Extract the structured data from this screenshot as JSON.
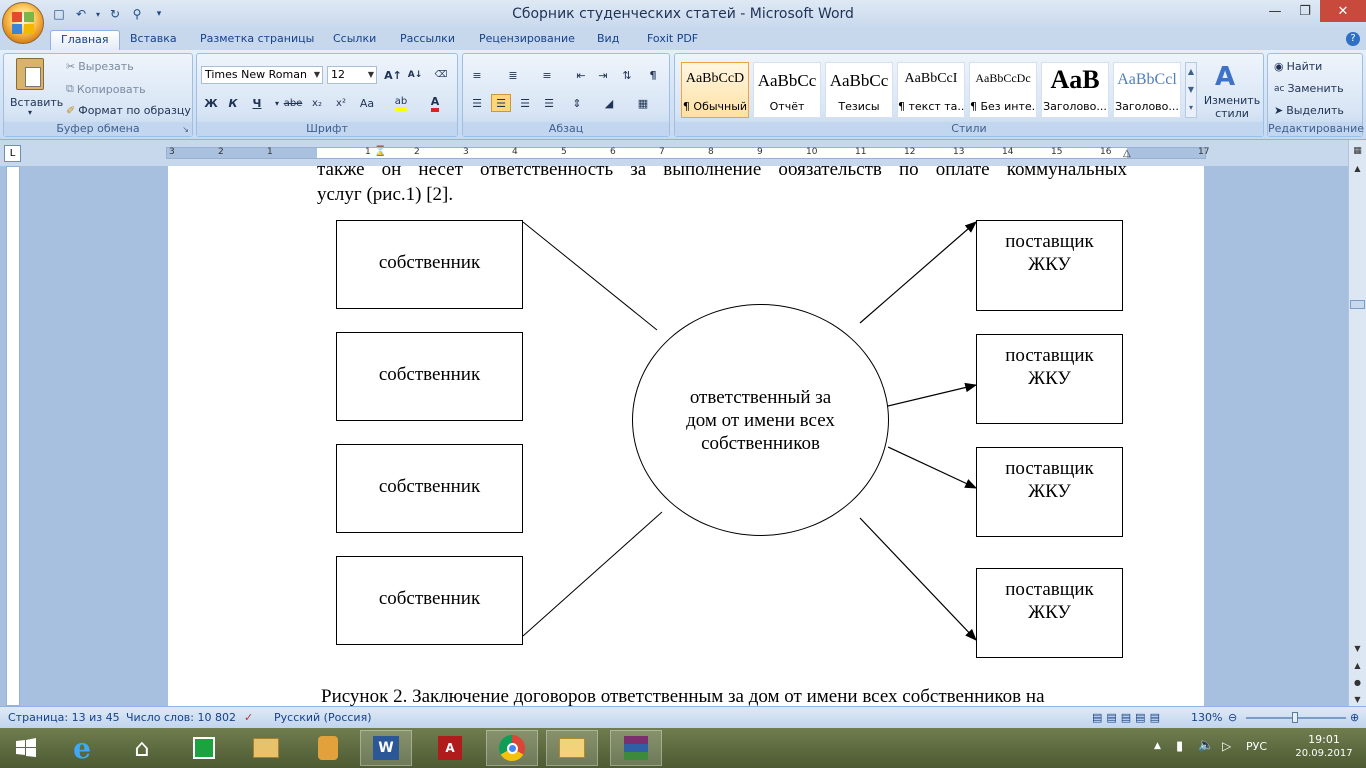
{
  "window": {
    "title": "Сборник студенческих статей - Microsoft Word"
  },
  "tabs": [
    "Главная",
    "Вставка",
    "Разметка страницы",
    "Ссылки",
    "Рассылки",
    "Рецензирование",
    "Вид",
    "Foxit PDF"
  ],
  "ribbon": {
    "clipboard": {
      "paste": "Вставить",
      "cut": "Вырезать",
      "copy": "Копировать",
      "format_painter": "Формат по образцу",
      "label": "Буфер обмена"
    },
    "font": {
      "name": "Times New Roman",
      "size": "12",
      "bold": "Ж",
      "italic": "К",
      "underline": "Ч",
      "strike": "abe",
      "sub": "x₂",
      "sup": "x²",
      "case": "Aa",
      "label": "Шрифт"
    },
    "paragraph": {
      "label": "Абзац"
    },
    "styles": {
      "label": "Стили",
      "items": [
        {
          "sample": "AaBbCcD",
          "name": "¶ Обычный"
        },
        {
          "sample": "AaBbCc",
          "name": "Отчёт"
        },
        {
          "sample": "AaBbCc",
          "name": "Тезисы"
        },
        {
          "sample": "AaBbCcI",
          "name": "¶ текст та..."
        },
        {
          "sample": "AaBbCcDc",
          "name": "¶ Без инте..."
        },
        {
          "sample": "AaB",
          "name": "Заголово..."
        },
        {
          "sample": "AaBbCcl",
          "name": "Заголово..."
        }
      ],
      "change": "Изменить стили"
    },
    "editing": {
      "find": "Найти",
      "replace": "Заменить",
      "select": "Выделить",
      "label": "Редактирование"
    }
  },
  "document": {
    "line1": "также он несет ответственность за выполнение обязательств по оплате коммунальных",
    "line2": "услуг (рис.1) [2].",
    "owners": [
      "собственник",
      "собственник",
      "собственник",
      "собственник"
    ],
    "center": "ответственный за дом от имени всех собственников",
    "suppliers": [
      "поставщик ЖКУ",
      "поставщик ЖКУ",
      "поставщик ЖКУ",
      "поставщик ЖКУ"
    ],
    "caption": "Рисунок 2. Заключение договоров ответственным за дом от имени всех собственников на"
  },
  "status": {
    "page": "Страница: 13 из 45",
    "words": "Число слов: 10 802",
    "lang": "Русский (Россия)",
    "zoom": "130%"
  },
  "tray": {
    "lang": "РУС",
    "time": "19:01",
    "date": "20.09.2017"
  }
}
